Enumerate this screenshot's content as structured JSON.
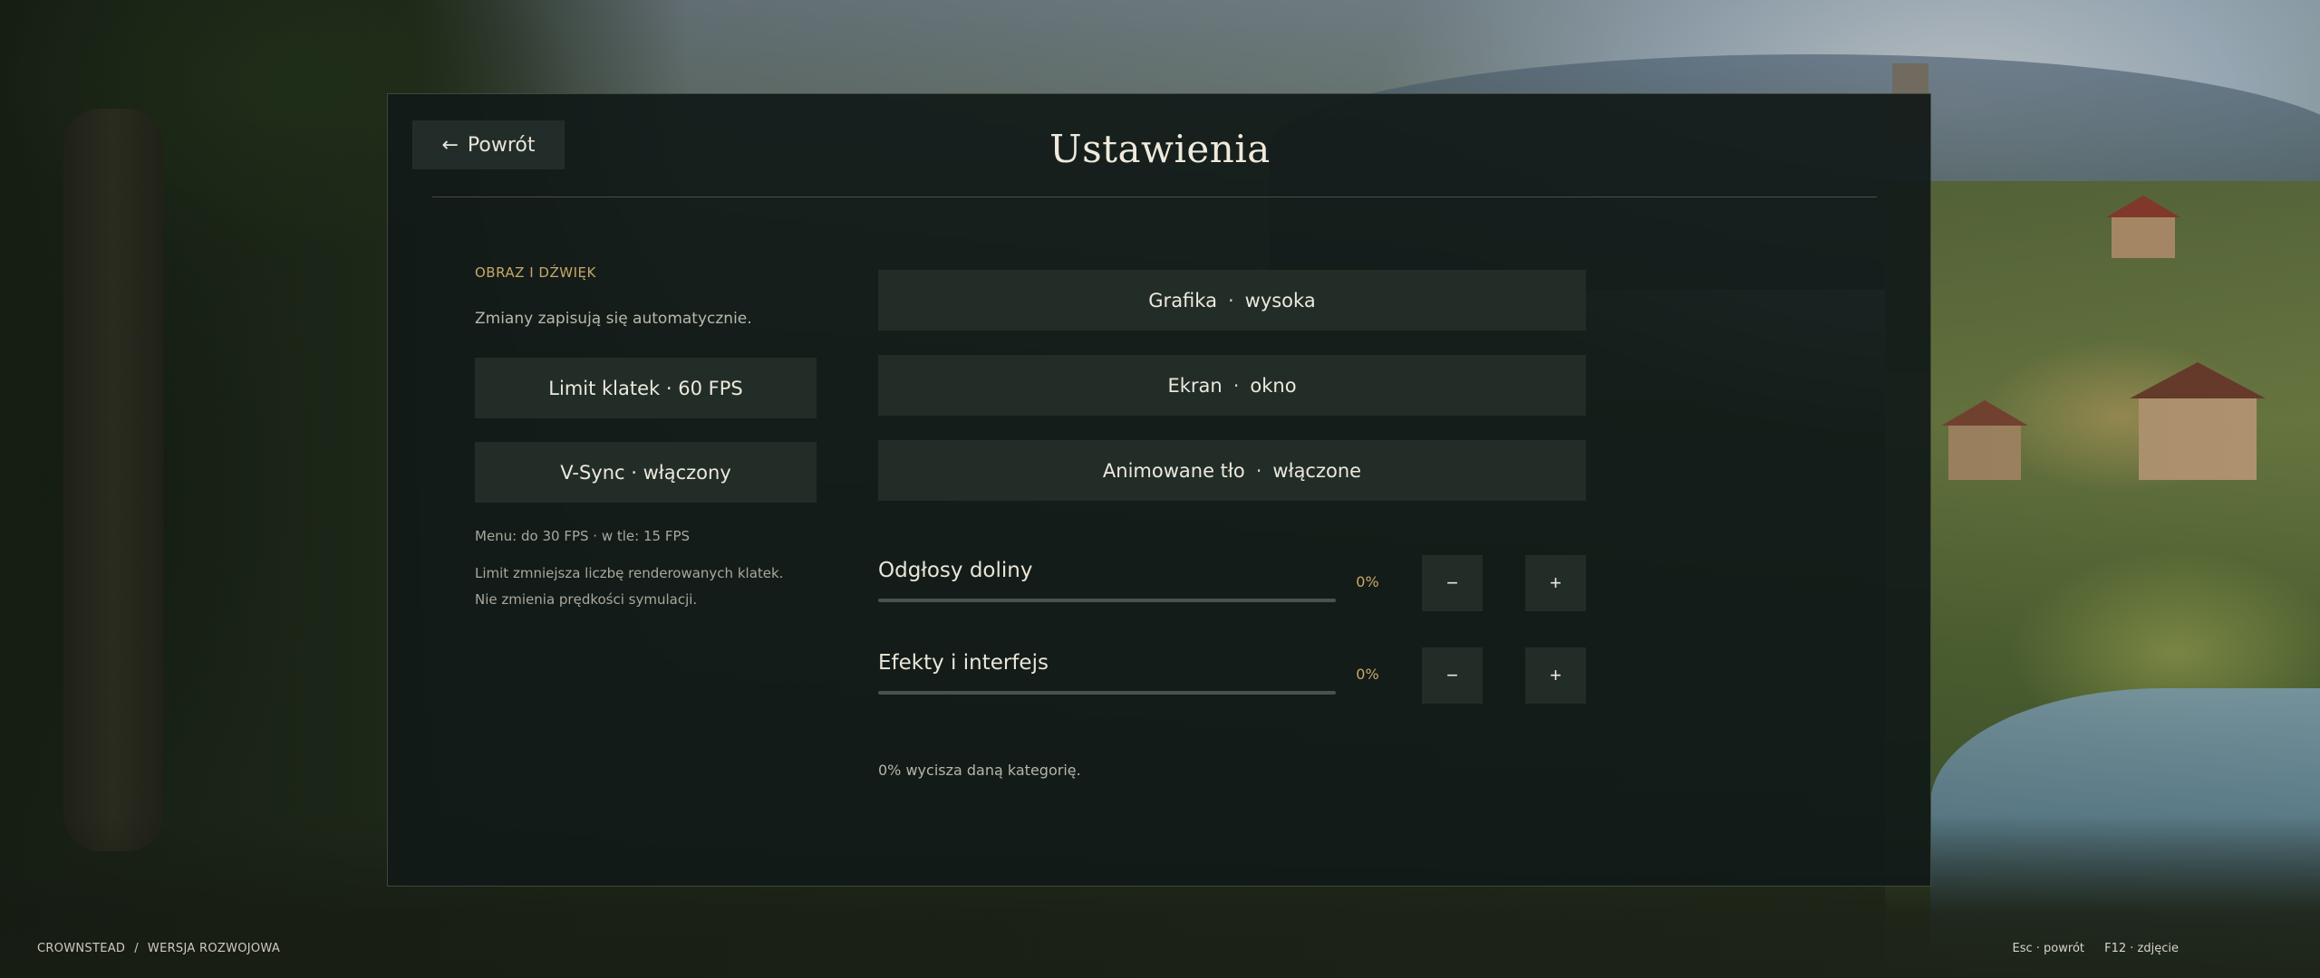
{
  "header": {
    "back_arrow_icon": "left-arrow",
    "back_label": "Powrót",
    "title": "Ustawienia"
  },
  "left": {
    "section_label": "OBRAZ I DŹWIĘK",
    "autosave_hint": "Zmiany zapisują się automatycznie.",
    "fps_limit_button": "Limit klatek · 60 FPS",
    "vsync_button": "V-Sync · włączony",
    "fps_note": "Menu: do 30 FPS · w tle: 15 FPS",
    "limit_note_line1": "Limit zmniejsza liczbę renderowanych klatek.",
    "limit_note_line2": "Nie zmienia prędkości symulacji."
  },
  "options": [
    {
      "label": "Grafika",
      "value": "wysoka"
    },
    {
      "label": "Ekran",
      "value": "okno"
    },
    {
      "label": "Animowane tło",
      "value": "włączone"
    }
  ],
  "separator": "·",
  "sliders": [
    {
      "label": "Odgłosy doliny",
      "percent_text": "0%",
      "value": 0
    },
    {
      "label": "Efekty i interfejs",
      "percent_text": "0%",
      "value": 0
    }
  ],
  "step_minus": "−",
  "step_plus": "+",
  "mute_note": "0% wycisza daną kategorię.",
  "footer": {
    "brand": "CROWNSTEAD",
    "slash": "/",
    "version": "WERSJA ROZWOJOWA",
    "hotkey_back": "Esc · powrót",
    "hotkey_screenshot": "F12 · zdjęcie"
  },
  "colors": {
    "accent": "#c9a86a",
    "panel_bg": "#111a18",
    "button_bg": "#222d28",
    "text": "#ece8dc"
  }
}
